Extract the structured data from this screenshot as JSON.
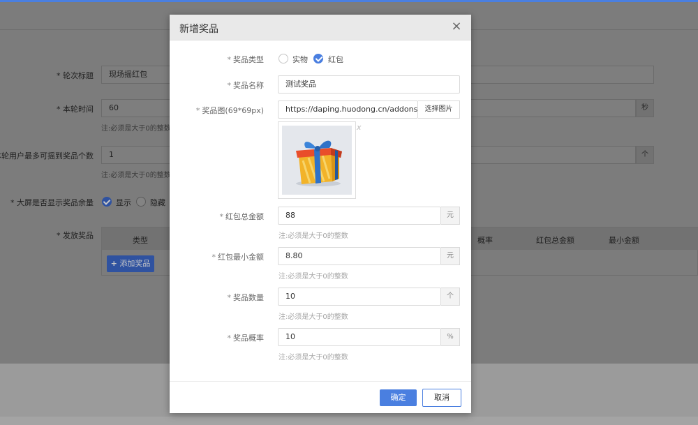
{
  "background": {
    "round_title": {
      "label": "* 轮次标题",
      "value": "现场摇红包"
    },
    "round_time": {
      "label": "* 本轮时间",
      "value": "60",
      "unit": "秒",
      "note": "注:必须是大于0的整数"
    },
    "max_per_user": {
      "label": "* 本轮用户最多可摇到奖品个数",
      "value": "1",
      "unit": "个",
      "note": "注:必须是大于0的整数"
    },
    "show_remaining": {
      "label": "* 大屏是否显示奖品余量",
      "options": [
        "显示",
        "隐藏"
      ],
      "selected": "显示"
    },
    "prizes": {
      "label": "* 发放奖品",
      "columns": [
        "类型",
        "概率",
        "红包总金额",
        "最小金额"
      ],
      "add_button": "添加奖品"
    }
  },
  "modal": {
    "title": "新增奖品",
    "prize_type": {
      "label": "奖品类型",
      "options": [
        "实物",
        "红包"
      ],
      "selected": "红包"
    },
    "prize_name": {
      "label": "奖品名称",
      "value": "测试奖品"
    },
    "prize_image": {
      "label": "奖品图(69*69px)",
      "value": "https://daping.huodong.cn/addons/r",
      "button": "选择图片",
      "remove": "x"
    },
    "total_amount": {
      "label": "红包总金额",
      "value": "88",
      "unit": "元",
      "note": "注:必须是大于0的整数"
    },
    "min_amount": {
      "label": "红包最小金额",
      "value": "8.80",
      "unit": "元",
      "note": "注:必须是大于0的整数"
    },
    "quantity": {
      "label": "奖品数量",
      "value": "10",
      "unit": "个",
      "note": "注:必须是大于0的整数"
    },
    "probability": {
      "label": "奖品概率",
      "value": "10",
      "unit": "%",
      "note": "注:必须是大于0的整数"
    },
    "confirm_label": "确定",
    "cancel_label": "取消"
  },
  "colors": {
    "primary": "#4a7fe0",
    "overlay": "#7c7c7c"
  },
  "icons": {
    "close": "close-icon",
    "check": "check-icon",
    "plus": "plus-icon",
    "gift": "gift-icon"
  }
}
